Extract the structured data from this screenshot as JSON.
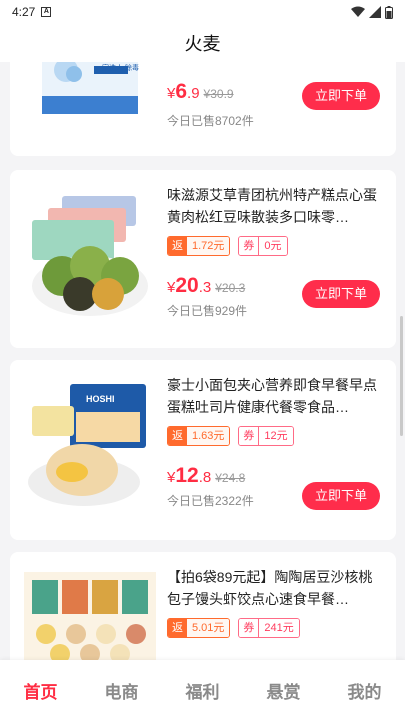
{
  "status_bar": {
    "time": "4:27",
    "sim_icon": "A"
  },
  "header": {
    "title": "火麦"
  },
  "products": [
    {
      "title": "",
      "rebate": "",
      "coupon": "",
      "price_currency": "¥",
      "price_int": "6",
      "price_dec": ".9",
      "original_price": "¥30.9",
      "sold": "今日已售8702件",
      "buy_label": "立即下单",
      "image_caption": "家洗人 除毒"
    },
    {
      "title": "味滋源艾草青团杭州特产糕点心蛋黄肉松红豆味散装多口味零…",
      "rebate_key": "返",
      "rebate": "1.72元",
      "coupon_key": "券",
      "coupon": "0元",
      "price_currency": "¥",
      "price_int": "20",
      "price_dec": ".3",
      "original_price": "¥20.3",
      "sold": "今日已售929件",
      "buy_label": "立即下单"
    },
    {
      "title": "豪士小面包夹心营养即食早餐早点蛋糕吐司片健康代餐零食品…",
      "rebate_key": "返",
      "rebate": "1.63元",
      "coupon_key": "券",
      "coupon": "12元",
      "price_currency": "¥",
      "price_int": "12",
      "price_dec": ".8",
      "original_price": "¥24.8",
      "sold": "今日已售2322件",
      "buy_label": "立即下单",
      "image_caption": "HOSHI"
    },
    {
      "title": "【拍6袋89元起】陶陶居豆沙核桃包子馒头虾饺点心速食早餐…",
      "rebate_key": "返",
      "rebate": "5.01元",
      "coupon_key": "券",
      "coupon": "241元"
    }
  ],
  "tabs": [
    {
      "label": "首页",
      "active": true
    },
    {
      "label": "电商",
      "active": false
    },
    {
      "label": "福利",
      "active": false
    },
    {
      "label": "悬赏",
      "active": false
    },
    {
      "label": "我的",
      "active": false
    }
  ],
  "colors": {
    "accent": "#ff2d43",
    "rebate": "#ff6a2d",
    "coupon": "#ff3d5f"
  }
}
